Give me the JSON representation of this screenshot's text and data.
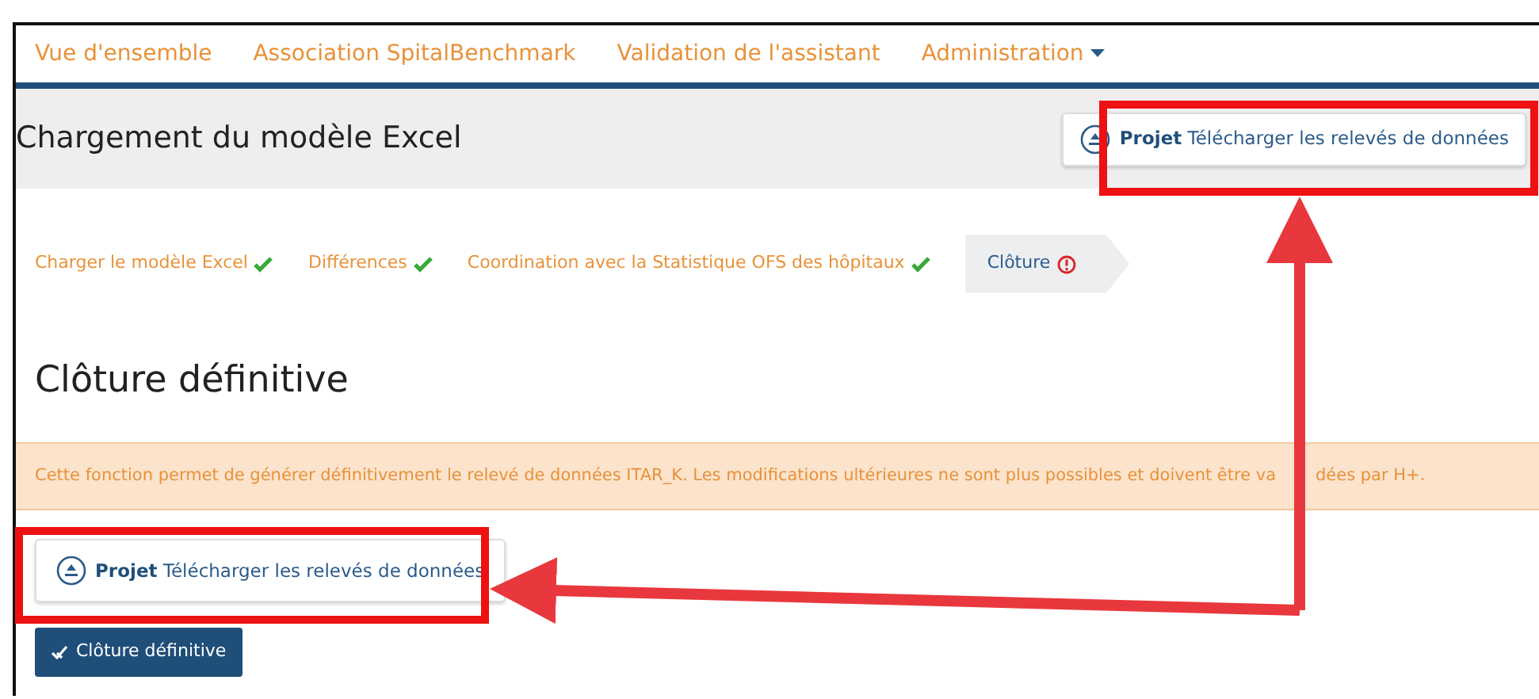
{
  "nav": [
    {
      "label": "Vue d'ensemble",
      "dropdown": false
    },
    {
      "label": "Association SpitalBenchmark",
      "dropdown": false
    },
    {
      "label": "Validation de l'assistant",
      "dropdown": false
    },
    {
      "label": "Administration",
      "dropdown": true
    }
  ],
  "header": {
    "title": "Chargement du modèle Excel",
    "button": {
      "bold": "Projet",
      "label": "Télécharger les relevés de données"
    }
  },
  "steps": [
    {
      "label": "Charger le modèle Excel",
      "completed": true,
      "selected": false
    },
    {
      "label": "Différences",
      "completed": true,
      "selected": false
    },
    {
      "label": "Coordination avec la Statistique OFS des hôpitaux",
      "completed": true,
      "selected": false
    },
    {
      "label": "Clôture",
      "completed": false,
      "selected": true
    }
  ],
  "heading": "Clôture définitive",
  "alert": [
    "Cette fonction permet de générer définitivement le relevé de données ITAR_K. Les modifications ultérieures ne sont plus possibles et doivent être va",
    "dées par H+."
  ],
  "download_button": {
    "bold": "Projet",
    "label": "Télécharger les relevés de données"
  },
  "submit_button": "Clôture définitive"
}
